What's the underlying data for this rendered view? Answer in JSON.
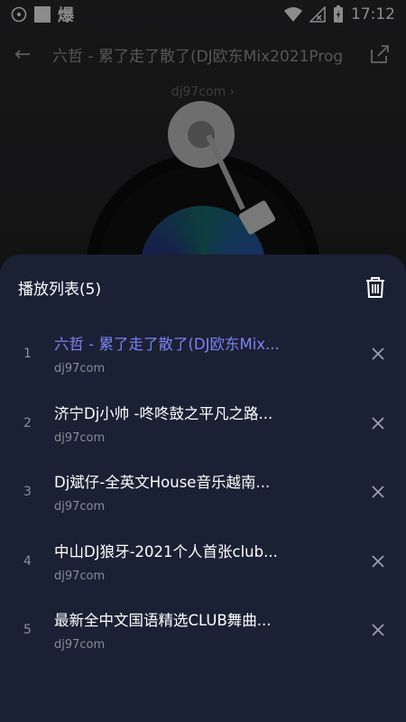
{
  "status_bar": {
    "time": "17:12",
    "notification_text": "爆"
  },
  "player": {
    "title": "六哲 - 累了走了散了(DJ欧东Mix2021Prog",
    "source_link": "dj97com ›"
  },
  "playlist": {
    "title": "播放列表(5)",
    "items": [
      {
        "index": "1",
        "song": "六哲 - 累了走了散了(DJ欧东Mix...",
        "source": "dj97com",
        "active": true
      },
      {
        "index": "2",
        "song": "济宁Dj小帅 -咚咚鼓之平凡之路...",
        "source": "dj97com",
        "active": false
      },
      {
        "index": "3",
        "song": "Dj斌仔-全英文House音乐越南...",
        "source": "dj97com",
        "active": false
      },
      {
        "index": "4",
        "song": "中山DJ狼牙-2021个人首张club...",
        "source": "dj97com",
        "active": false
      },
      {
        "index": "5",
        "song": "最新全中文国语精选CLUB舞曲...",
        "source": "dj97com",
        "active": false
      }
    ]
  },
  "colors": {
    "active_song": "#7d82f0",
    "sheet_bg": "#1b2134"
  }
}
